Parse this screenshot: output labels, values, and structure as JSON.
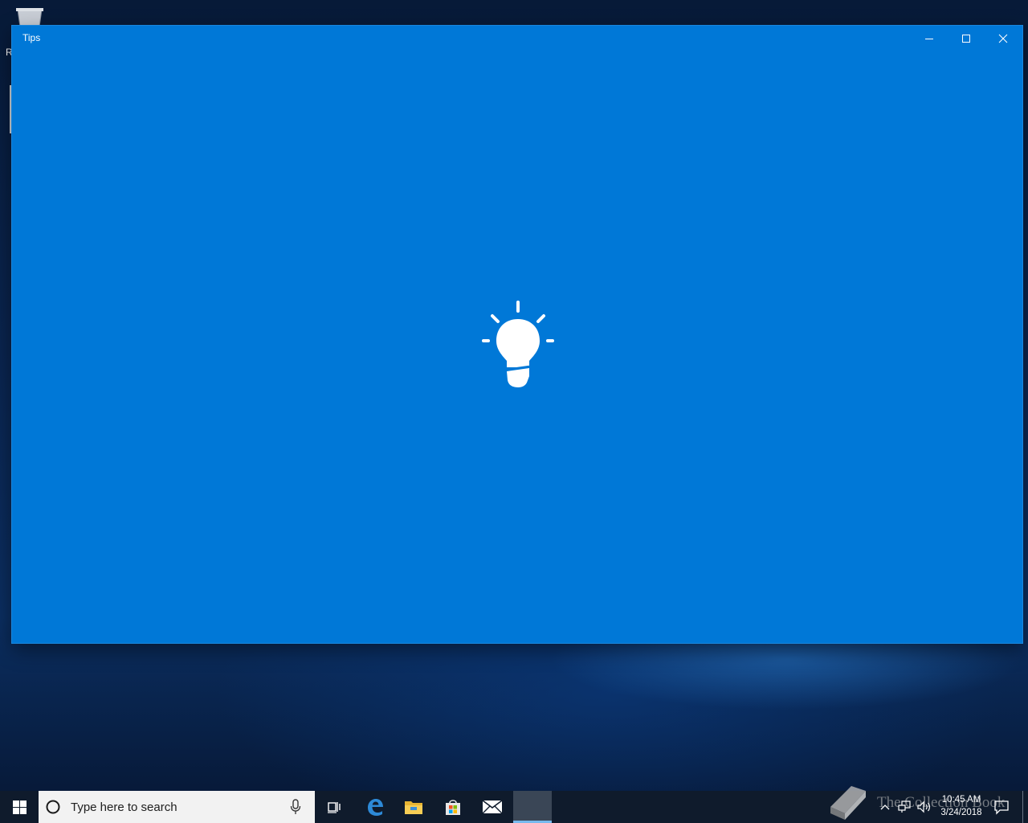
{
  "desktop": {
    "recycle_bin_label": "R"
  },
  "window": {
    "title": "Tips",
    "splash_icon": "lightbulb-icon",
    "background_color": "#0078d7",
    "controls": {
      "minimize": "minimize-icon",
      "maximize": "maximize-icon",
      "close": "close-icon"
    }
  },
  "taskbar": {
    "search_placeholder": "Type here to search",
    "apps": [
      "task-view-icon",
      "edge-icon",
      "file-explorer-icon",
      "store-icon",
      "mail-icon",
      "tips-app-icon"
    ],
    "active_app": "Tips",
    "clock": {
      "time": "10:45 AM",
      "date": "3/24/2018"
    }
  },
  "watermark": {
    "text": "The Collection Book"
  }
}
